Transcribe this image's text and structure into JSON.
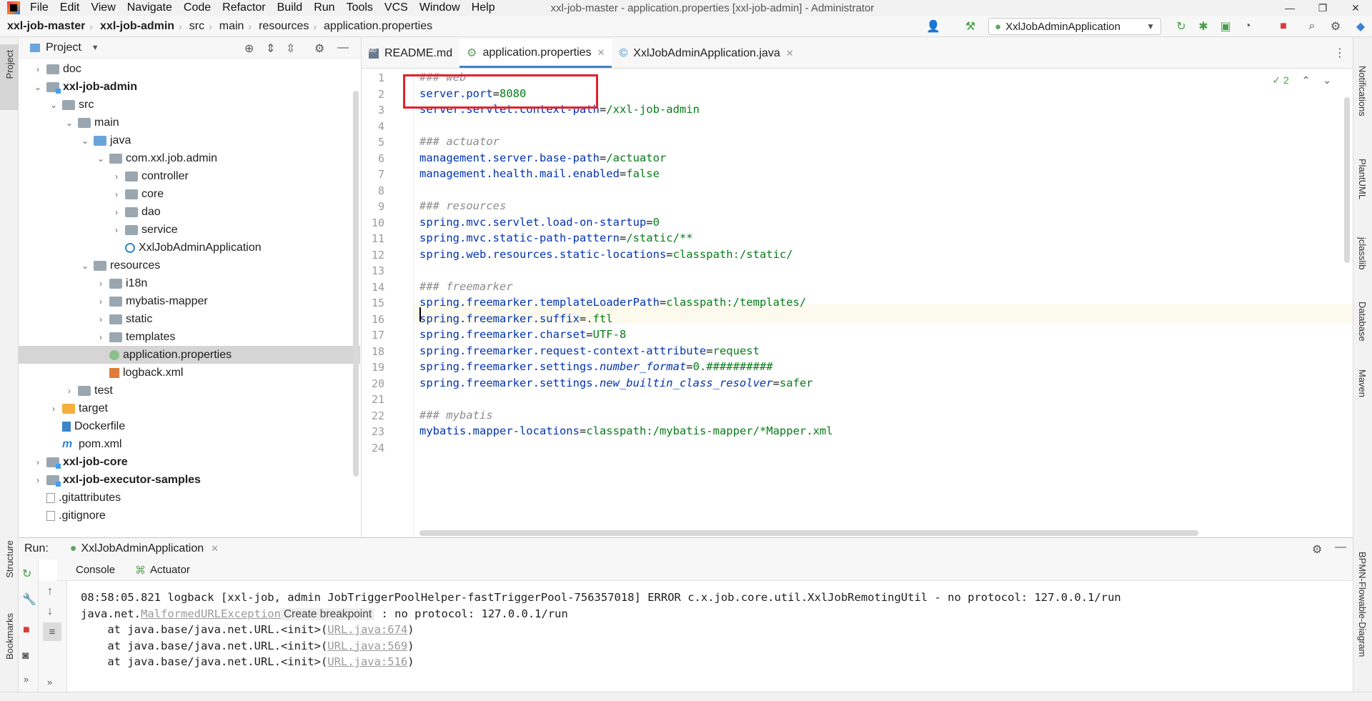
{
  "menu": [
    "File",
    "Edit",
    "View",
    "Navigate",
    "Code",
    "Refactor",
    "Build",
    "Run",
    "Tools",
    "VCS",
    "Window",
    "Help"
  ],
  "window_title": "xxl-job-master - application.properties [xxl-job-admin] - Administrator",
  "breadcrumbs": [
    "xxl-job-master",
    "xxl-job-admin",
    "src",
    "main",
    "resources",
    "application.properties"
  ],
  "run_config": "XxlJobAdminApplication",
  "left_stripe": {
    "project": "Project",
    "structure": "Structure",
    "bookmarks": "Bookmarks"
  },
  "right_stripe": {
    "notifications": "Notifications",
    "plantuml": "PlantUML",
    "jclasslib": "jclasslib",
    "database": "Database",
    "maven": "Maven",
    "bpmn": "BPMN-Flowable-Diagram"
  },
  "project_panel": {
    "title": "Project",
    "tree": [
      {
        "label": "doc",
        "depth": 1,
        "kind": "folder",
        "expand": "closed"
      },
      {
        "label": "xxl-job-admin",
        "depth": 1,
        "kind": "module",
        "expand": "open",
        "bold": true
      },
      {
        "label": "src",
        "depth": 2,
        "kind": "folder",
        "expand": "open"
      },
      {
        "label": "main",
        "depth": 3,
        "kind": "folder",
        "expand": "open"
      },
      {
        "label": "java",
        "depth": 4,
        "kind": "folder-blue",
        "expand": "open"
      },
      {
        "label": "com.xxl.job.admin",
        "depth": 5,
        "kind": "folder",
        "expand": "open"
      },
      {
        "label": "controller",
        "depth": 6,
        "kind": "folder",
        "expand": "closed"
      },
      {
        "label": "core",
        "depth": 6,
        "kind": "folder",
        "expand": "closed"
      },
      {
        "label": "dao",
        "depth": 6,
        "kind": "folder",
        "expand": "closed"
      },
      {
        "label": "service",
        "depth": 6,
        "kind": "folder",
        "expand": "closed"
      },
      {
        "label": "XxlJobAdminApplication",
        "depth": 6,
        "kind": "class",
        "expand": "none"
      },
      {
        "label": "resources",
        "depth": 4,
        "kind": "folder",
        "expand": "open"
      },
      {
        "label": "i18n",
        "depth": 5,
        "kind": "folder",
        "expand": "closed"
      },
      {
        "label": "mybatis-mapper",
        "depth": 5,
        "kind": "folder",
        "expand": "closed"
      },
      {
        "label": "static",
        "depth": 5,
        "kind": "folder",
        "expand": "closed"
      },
      {
        "label": "templates",
        "depth": 5,
        "kind": "folder",
        "expand": "closed"
      },
      {
        "label": "application.properties",
        "depth": 5,
        "kind": "properties",
        "expand": "none",
        "selected": true
      },
      {
        "label": "logback.xml",
        "depth": 5,
        "kind": "xml",
        "expand": "none"
      },
      {
        "label": "test",
        "depth": 3,
        "kind": "folder",
        "expand": "closed"
      },
      {
        "label": "target",
        "depth": 2,
        "kind": "folder-orange",
        "expand": "closed"
      },
      {
        "label": "Dockerfile",
        "depth": 2,
        "kind": "docker",
        "expand": "none"
      },
      {
        "label": "pom.xml",
        "depth": 2,
        "kind": "maven",
        "expand": "none"
      },
      {
        "label": "xxl-job-core",
        "depth": 1,
        "kind": "module",
        "expand": "closed",
        "bold": true
      },
      {
        "label": "xxl-job-executor-samples",
        "depth": 1,
        "kind": "module",
        "expand": "closed",
        "bold": true
      },
      {
        "label": ".gitattributes",
        "depth": 1,
        "kind": "file",
        "expand": "none"
      },
      {
        "label": ".gitignore",
        "depth": 1,
        "kind": "file",
        "expand": "none"
      }
    ]
  },
  "tabs": [
    {
      "label": "README.md",
      "active": false
    },
    {
      "label": "application.properties",
      "active": true
    },
    {
      "label": "XxlJobAdminApplication.java",
      "active": false
    }
  ],
  "inspection_count": "2",
  "editor": {
    "lines": [
      {
        "n": "1",
        "parts": [
          {
            "t": "### web",
            "c": "c"
          }
        ]
      },
      {
        "n": "2",
        "parts": [
          {
            "t": "server.port",
            "c": "k"
          },
          {
            "t": "=",
            "c": ""
          },
          {
            "t": "8080",
            "c": "v"
          }
        ]
      },
      {
        "n": "3",
        "parts": [
          {
            "t": "server.servlet.context-path",
            "c": "k"
          },
          {
            "t": "=",
            "c": ""
          },
          {
            "t": "/xxl-job-admin",
            "c": "v"
          }
        ]
      },
      {
        "n": "4",
        "parts": []
      },
      {
        "n": "5",
        "parts": [
          {
            "t": "### actuator",
            "c": "c"
          }
        ]
      },
      {
        "n": "6",
        "parts": [
          {
            "t": "management.server.base-path",
            "c": "k"
          },
          {
            "t": "=",
            "c": ""
          },
          {
            "t": "/actuator",
            "c": "v"
          }
        ]
      },
      {
        "n": "7",
        "parts": [
          {
            "t": "management.health.mail.enabled",
            "c": "k"
          },
          {
            "t": "=",
            "c": ""
          },
          {
            "t": "false",
            "c": "v"
          }
        ]
      },
      {
        "n": "8",
        "parts": []
      },
      {
        "n": "9",
        "parts": [
          {
            "t": "### resources",
            "c": "c"
          }
        ]
      },
      {
        "n": "10",
        "parts": [
          {
            "t": "spring.mvc.servlet.load-on-startup",
            "c": "k"
          },
          {
            "t": "=",
            "c": ""
          },
          {
            "t": "0",
            "c": "v"
          }
        ]
      },
      {
        "n": "11",
        "parts": [
          {
            "t": "spring.mvc.static-path-pattern",
            "c": "k"
          },
          {
            "t": "=",
            "c": ""
          },
          {
            "t": "/static/**",
            "c": "v"
          }
        ]
      },
      {
        "n": "12",
        "parts": [
          {
            "t": "spring.web.resources.static-locations",
            "c": "k"
          },
          {
            "t": "=",
            "c": ""
          },
          {
            "t": "classpath:/static/",
            "c": "v"
          }
        ]
      },
      {
        "n": "13",
        "parts": []
      },
      {
        "n": "14",
        "parts": [
          {
            "t": "### freemarker",
            "c": "c"
          }
        ]
      },
      {
        "n": "15",
        "parts": [
          {
            "t": "spring.freemarker.templateLoaderPath",
            "c": "k"
          },
          {
            "t": "=",
            "c": ""
          },
          {
            "t": "classpath:/templates/",
            "c": "v"
          }
        ]
      },
      {
        "n": "16",
        "parts": [
          {
            "t": "spring.freemarker.suffix",
            "c": "k"
          },
          {
            "t": "=",
            "c": ""
          },
          {
            "t": ".ftl",
            "c": "v"
          }
        ]
      },
      {
        "n": "17",
        "parts": [
          {
            "t": "spring.freemarker.charset",
            "c": "k"
          },
          {
            "t": "=",
            "c": ""
          },
          {
            "t": "UTF-8",
            "c": "v"
          }
        ]
      },
      {
        "n": "18",
        "parts": [
          {
            "t": "spring.freemarker.request-context-attribute",
            "c": "k"
          },
          {
            "t": "=",
            "c": ""
          },
          {
            "t": "request",
            "c": "v"
          }
        ]
      },
      {
        "n": "19",
        "parts": [
          {
            "t": "spring.freemarker.settings.",
            "c": "k"
          },
          {
            "t": "number_format",
            "c": "k i"
          },
          {
            "t": "=",
            "c": ""
          },
          {
            "t": "0.##########",
            "c": "v"
          }
        ]
      },
      {
        "n": "20",
        "parts": [
          {
            "t": "spring.freemarker.settings.",
            "c": "k"
          },
          {
            "t": "new_builtin_class_resolver",
            "c": "k i"
          },
          {
            "t": "=",
            "c": ""
          },
          {
            "t": "safer",
            "c": "v"
          }
        ]
      },
      {
        "n": "21",
        "parts": []
      },
      {
        "n": "22",
        "parts": [
          {
            "t": "### mybatis",
            "c": "c"
          }
        ]
      },
      {
        "n": "23",
        "parts": [
          {
            "t": "mybatis.mapper-locations",
            "c": "k"
          },
          {
            "t": "=",
            "c": ""
          },
          {
            "t": "classpath:/mybatis-mapper/*Mapper.xml",
            "c": "v"
          }
        ]
      },
      {
        "n": "24",
        "parts": []
      }
    ]
  },
  "run_panel": {
    "label": "Run:",
    "config": "XxlJobAdminApplication",
    "tabs": [
      "Console",
      "Actuator"
    ],
    "console": [
      {
        "parts": [
          {
            "t": "08:58:05.821 logback [xxl-job, admin JobTriggerPoolHelper-fastTriggerPool-756357018] ERROR c.x.job.core.util.XxlJobRemotingUtil - no protocol: 127.0.0.1/run",
            "c": ""
          }
        ]
      },
      {
        "parts": [
          {
            "t": "java.net.",
            "c": ""
          },
          {
            "t": "MalformedURLException",
            "c": "link"
          },
          {
            "t": "Create breakpoint",
            "c": "tooltip"
          },
          {
            "t": " : no protocol: 127.0.0.1/run",
            "c": ""
          }
        ]
      },
      {
        "parts": [
          {
            "t": "    at java.base/java.net.URL.<init>(",
            "c": ""
          },
          {
            "t": "URL.java:674",
            "c": "link"
          },
          {
            "t": ")",
            "c": ""
          }
        ]
      },
      {
        "parts": [
          {
            "t": "    at java.base/java.net.URL.<init>(",
            "c": ""
          },
          {
            "t": "URL.java:569",
            "c": "link"
          },
          {
            "t": ")",
            "c": ""
          }
        ]
      },
      {
        "parts": [
          {
            "t": "    at java.base/java.net.URL.<init>(",
            "c": ""
          },
          {
            "t": "URL.java:516",
            "c": "link"
          },
          {
            "t": ")",
            "c": ""
          }
        ]
      }
    ]
  },
  "colors": {
    "keyword": "#0033b3",
    "value": "#067d17",
    "comment": "#8c8c8c",
    "highlight_box": "#e4202b",
    "tab_underline": "#4083c9"
  }
}
